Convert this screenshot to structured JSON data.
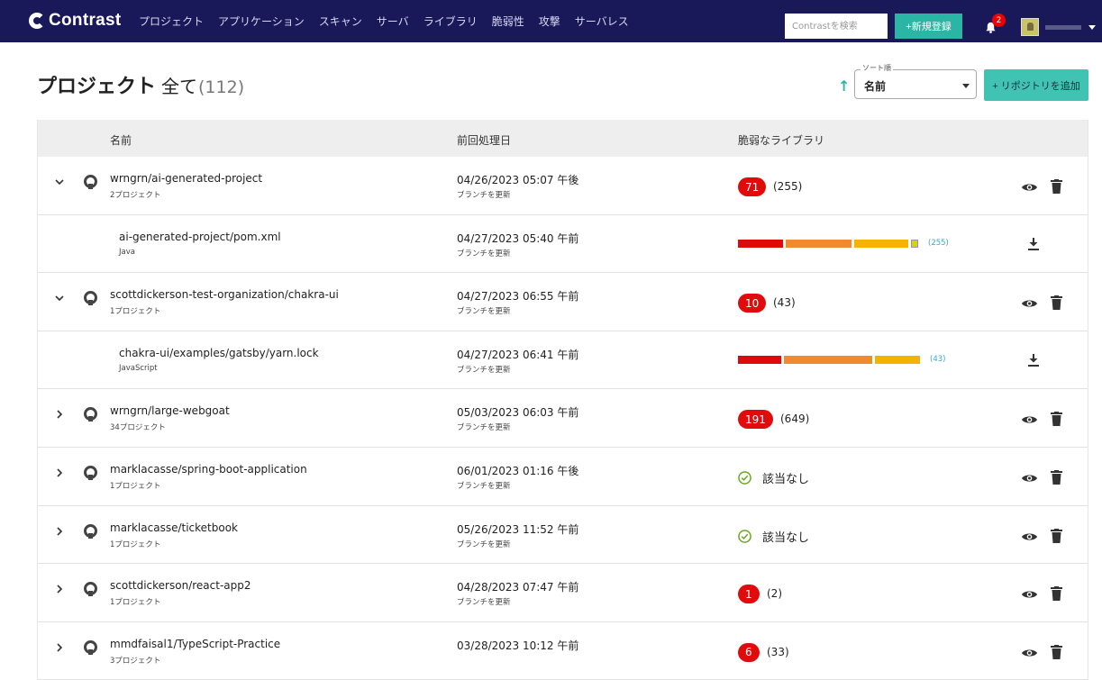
{
  "nav": {
    "logo": "Contrast",
    "items": [
      "プロジェクト",
      "アプリケーション",
      "スキャン",
      "サーバ",
      "ライブラリ",
      "脆弱性",
      "攻撃",
      "サーバレス"
    ],
    "search_placeholder": "Contrastを検索",
    "new_button": "+新規登録",
    "notification_count": "2"
  },
  "header": {
    "title": "プロジェクト",
    "filter": "全て",
    "count": "(112)",
    "sort_label": "ソート順",
    "sort_value": "名前",
    "add_repo_button": "+ リポジトリを追加"
  },
  "table": {
    "columns": [
      "名前",
      "前回処理日",
      "脆弱なライブラリ"
    ],
    "rows": [
      {
        "kind": "repo",
        "expanded": true,
        "name": "wrngrn/ai-generated-project",
        "sub": "2プロジェクト",
        "date": "04/26/2023 05:07 午後",
        "branch": "ブランチを更新",
        "vuln": "71",
        "total": "(255)"
      },
      {
        "kind": "child",
        "name": "ai-generated-project/pom.xml",
        "sub": "Java",
        "date": "04/27/2023 05:40 午前",
        "branch": "ブランチを更新",
        "total": "(255)",
        "bars": [
          {
            "color": "#dd0a0a",
            "w": 0.2
          },
          {
            "color": "#f08a30",
            "w": 0.29
          },
          {
            "color": "#f2b400",
            "w": 0.24
          },
          {
            "color": "#d6d214",
            "w": 0.03
          }
        ]
      },
      {
        "kind": "repo",
        "expanded": true,
        "name": "scottdickerson-test-organization/chakra-ui",
        "sub": "1プロジェクト",
        "date": "04/27/2023 06:55 午前",
        "branch": "ブランチを更新",
        "vuln": "10",
        "total": "(43)"
      },
      {
        "kind": "child",
        "name": "chakra-ui/examples/gatsby/yarn.lock",
        "sub": "JavaScript",
        "date": "04/27/2023 06:41 午前",
        "branch": "ブランチを更新",
        "total": "(43)",
        "bars": [
          {
            "color": "#dd0a0a",
            "w": 0.19
          },
          {
            "color": "#f08a30",
            "w": 0.39
          },
          {
            "color": "#f2b400",
            "w": 0.2
          }
        ]
      },
      {
        "kind": "repo",
        "expanded": false,
        "name": "wrngrn/large-webgoat",
        "sub": "34プロジェクト",
        "date": "05/03/2023 06:03 午前",
        "branch": "ブランチを更新",
        "vuln": "191",
        "total": "(649)"
      },
      {
        "kind": "repo",
        "expanded": false,
        "name": "marklacasse/spring-boot-application",
        "sub": "1プロジェクト",
        "date": "06/01/2023 01:16 午後",
        "branch": "ブランチを更新",
        "none": "該当なし"
      },
      {
        "kind": "repo",
        "expanded": false,
        "name": "marklacasse/ticketbook",
        "sub": "1プロジェクト",
        "date": "05/26/2023 11:52 午前",
        "branch": "ブランチを更新",
        "none": "該当なし"
      },
      {
        "kind": "repo",
        "expanded": false,
        "name": "scottdickerson/react-app2",
        "sub": "1プロジェクト",
        "date": "04/28/2023 07:47 午前",
        "branch": "ブランチを更新",
        "vuln": "1",
        "total": "(2)"
      },
      {
        "kind": "repo",
        "expanded": false,
        "name": "mmdfaisal1/TypeScript-Practice",
        "sub": "3プロジェクト",
        "date": "03/28/2023 10:12 午前",
        "branch": "",
        "vuln": "6",
        "total": "(33)"
      }
    ]
  },
  "colors": {
    "nav": "#19195a",
    "accent": "#2ab5a4",
    "danger": "#e00c0c",
    "ok": "#6aa81e"
  }
}
